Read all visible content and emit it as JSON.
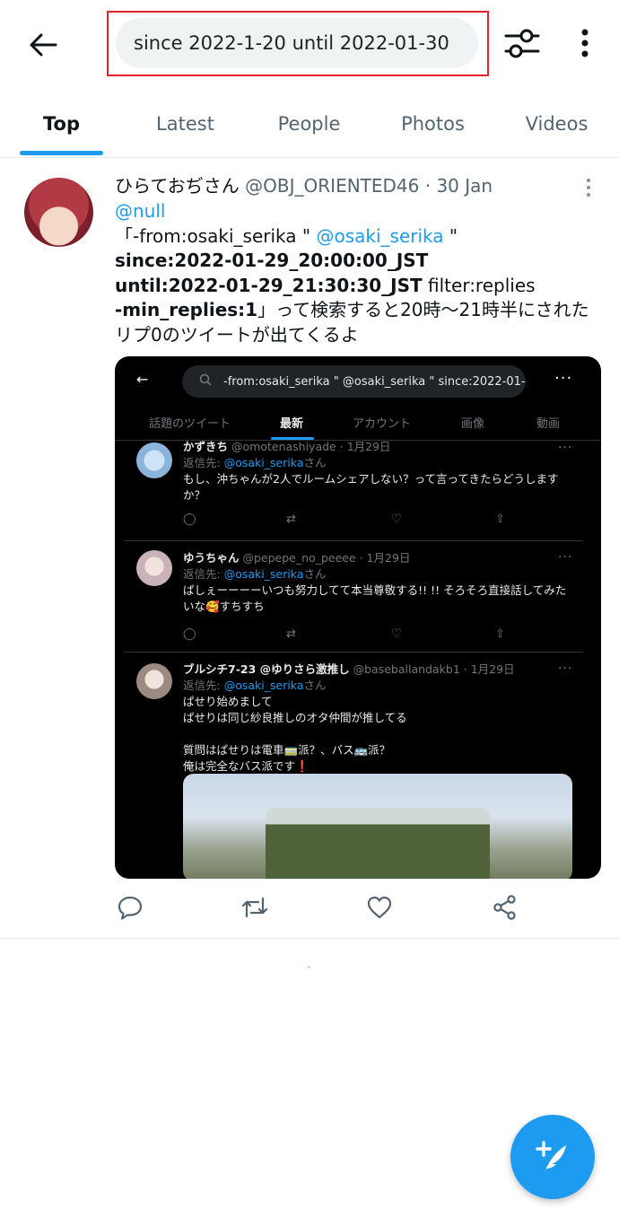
{
  "search": {
    "query": "since 2022-1-20 until 2022-01-30"
  },
  "tabs": [
    {
      "label": "Top",
      "active": true
    },
    {
      "label": "Latest"
    },
    {
      "label": "People"
    },
    {
      "label": "Photos"
    },
    {
      "label": "Videos"
    }
  ],
  "tweet": {
    "name": "ひらておぢさん",
    "handle": "@OBJ_ORIENTED46",
    "separator": "·",
    "date": "30 Jan",
    "mention": "@null",
    "text_open": "「-from:osaki_serika \"",
    "text_mention": "@osaki_serika",
    "text_close": "\"",
    "since": "since:2022-01-29_20:00:00_JST",
    "until": "until:2022-01-29_21:30:30_JST",
    "filter": "filter:replies",
    "min_replies": "-min_replies:1",
    "tail": "」って検索すると20時〜21時半にされたリプ0のツイートが出てくるよ"
  },
  "embedded": {
    "search": "-from:osaki_serika \" @osaki_serika \" since:2022-01-2",
    "tabs": [
      "話題のツイート",
      "最新",
      "アカウント",
      "画像",
      "動画"
    ],
    "reply_prefix": "返信先:",
    "reply_handle": "@osaki_serika",
    "reply_suffix": "さん",
    "posts": [
      {
        "name": "かずきち",
        "handle": "@omotenashiyade",
        "date": "1月29日",
        "lines": [
          "もし、沖ちゃんが2人でルームシェアしない？って言ってきたらどうします",
          "か？"
        ]
      },
      {
        "name": "ゆうちゃん",
        "handle": "@pepepe_no_peeee",
        "date": "1月29日",
        "lines": [
          "ぱしぇーーーーいつも努力してて本当尊敬する!! !! そろそろ直接話してみた",
          "いな🥰すちすち"
        ]
      },
      {
        "name": "ブルシチ7-23 @ゆりさら激推し",
        "handle": "@baseballandakb1",
        "date": "1月29日",
        "lines": [
          "ぱせり始めまして",
          "ぱせりは同じ紗良推しのオタ仲間が推してる",
          "",
          "質問はぱせりは電車🚃派？、バス🚌派？",
          "俺は完全なバス派です❗"
        ]
      }
    ]
  },
  "colors": {
    "accent": "#1d9bf0",
    "highlight_border": "#e0232b"
  }
}
